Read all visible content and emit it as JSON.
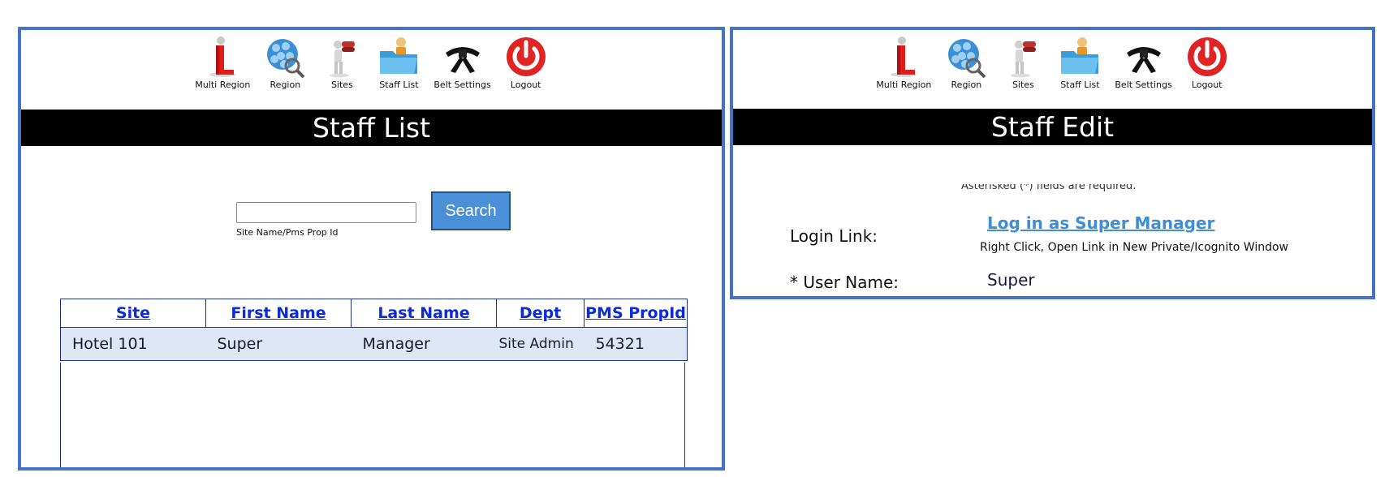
{
  "nav": {
    "items": [
      {
        "label": "Multi Region",
        "icon": "multi-region-icon"
      },
      {
        "label": "Region",
        "icon": "region-globe-icon"
      },
      {
        "label": "Sites",
        "icon": "sites-binoculars-icon"
      },
      {
        "label": "Staff List",
        "icon": "staff-folder-icon"
      },
      {
        "label": "Belt Settings",
        "icon": "black-belt-icon"
      },
      {
        "label": "Logout",
        "icon": "power-icon"
      }
    ]
  },
  "staff_list": {
    "title": "Staff List",
    "search": {
      "value": "",
      "placeholder": "",
      "hint": "Site Name/Pms Prop Id",
      "button": "Search"
    },
    "columns": [
      "Site",
      "First Name",
      "Last Name",
      "Dept",
      "PMS PropId"
    ],
    "rows": [
      {
        "site": "Hotel 101",
        "first_name": "Super",
        "last_name": "Manager",
        "dept": "Site Admin",
        "pms_prop_id": "54321"
      }
    ]
  },
  "staff_edit": {
    "title": "Staff Edit",
    "required_note": "Asterisked (*) fields are required.",
    "login_link_label": "Login Link:",
    "login_link_text": "Log in as Super Manager",
    "login_link_hint": "Right Click, Open Link in New Private/Icognito Window",
    "user_name_label": "* User Name:",
    "user_name_value": "Super"
  },
  "colors": {
    "panel_border": "#4472c4",
    "title_bar": "#000000",
    "search_button": "#4a90d9",
    "table_header_text": "#0b2bd6",
    "table_row_bg": "#dce6f4",
    "login_link": "#3e8ed6"
  }
}
